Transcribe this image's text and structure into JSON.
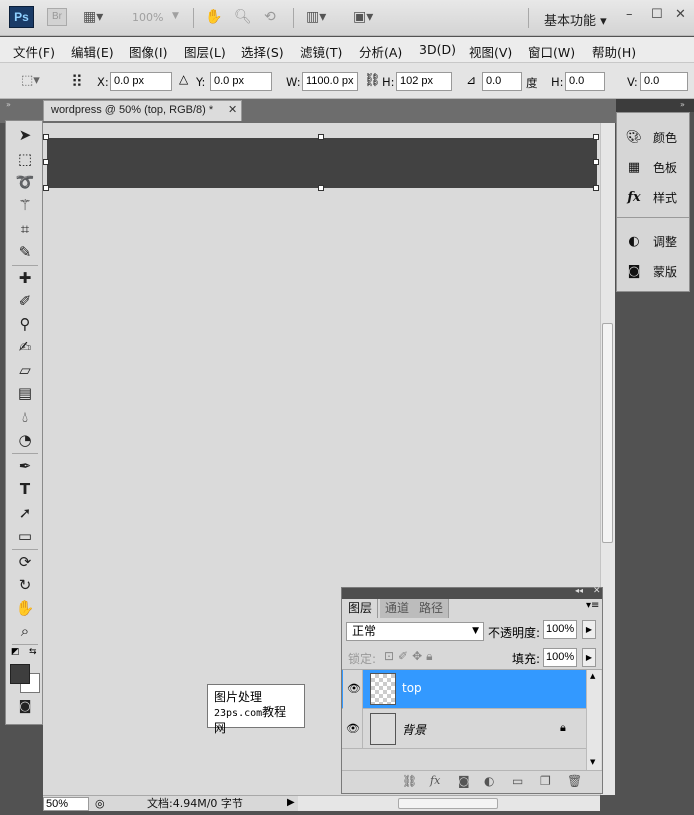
{
  "app": {
    "logo": "Ps",
    "bridge": "Br",
    "zoom": "100%",
    "workspace": "基本功能"
  },
  "menu": [
    "文件(F)",
    "编辑(E)",
    "图像(I)",
    "图层(L)",
    "选择(S)",
    "滤镜(T)",
    "分析(A)",
    "3D(D)",
    "视图(V)",
    "窗口(W)",
    "帮助(H)"
  ],
  "options": {
    "x_label": "X:",
    "x": "0.0 px",
    "y_label": "Y:",
    "y": "0.0 px",
    "w_label": "W:",
    "w": "1100.0 px",
    "h_label": "H:",
    "h": "102 px",
    "angle": "0.0",
    "deg": "度",
    "hskew_label": "H:",
    "hskew": "0.0",
    "vskew_label": "V:",
    "vskew": "0.0"
  },
  "document": {
    "tab": "wordpress @ 50% (top, RGB/8) *",
    "zoom": "50%",
    "info": "文档:4.94M/0 字节"
  },
  "dock": [
    {
      "label": "颜色",
      "icon": "palette-icon"
    },
    {
      "label": "色板",
      "icon": "swatches-icon"
    },
    {
      "label": "样式",
      "icon": "fx-icon"
    },
    {
      "label": "调整",
      "icon": "adjustments-icon"
    },
    {
      "label": "蒙版",
      "icon": "mask-icon"
    }
  ],
  "layers_panel": {
    "tabs": [
      "图层",
      "通道",
      "路径"
    ],
    "blend_mode": "正常",
    "opacity_label": "不透明度:",
    "opacity": "100%",
    "lock_label": "锁定:",
    "fill_label": "填充:",
    "fill": "100%",
    "layers": [
      {
        "name": "top",
        "selected": true
      },
      {
        "name": "背景",
        "locked": true
      }
    ]
  },
  "watermark": {
    "line1": "图片处理",
    "line1b": "教程网",
    "line2": "23ps.com"
  },
  "colors": {
    "selection": "#3399ff",
    "shape": "#424242",
    "canvas": "#dadada"
  }
}
